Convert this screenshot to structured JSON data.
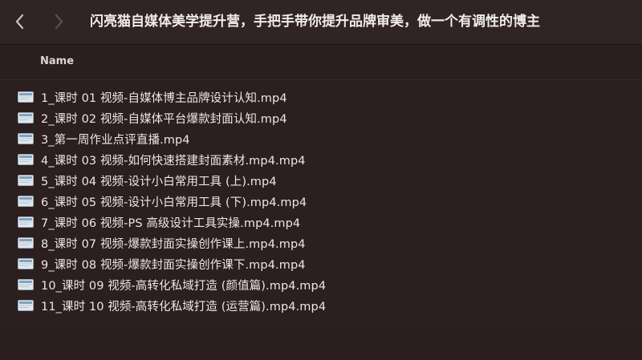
{
  "window": {
    "title": "闪亮猫自媒体美学提升营，手把手带你提升品牌审美，做一个有调性的博主"
  },
  "toolbar": {
    "back_icon": "chevron-left-icon",
    "forward_icon": "chevron-right-icon"
  },
  "list_header": {
    "name_label": "Name"
  },
  "files": [
    {
      "name": "1_课时 01 视频-自媒体博主品牌设计认知.mp4"
    },
    {
      "name": "2_课时 02 视频-自媒体平台爆款封面认知.mp4"
    },
    {
      "name": "3_第一周作业点评直播.mp4"
    },
    {
      "name": "4_课时 03 视频-如何快速搭建封面素材.mp4.mp4"
    },
    {
      "name": "5_课时 04 视频-设计小白常用工具 (上).mp4"
    },
    {
      "name": "6_课时 05 视频-设计小白常用工具 (下).mp4.mp4"
    },
    {
      "name": "7_课时 06 视频-PS 高级设计工具实操.mp4.mp4"
    },
    {
      "name": "8_课时 07 视频-爆款封面实操创作课上.mp4.mp4"
    },
    {
      "name": "9_课时 08 视频-爆款封面实操创作课下.mp4.mp4"
    },
    {
      "name": "10_课时 09 视频-高转化私域打造 (颜值篇).mp4.mp4"
    },
    {
      "name": "11_课时 10 视频-高转化私域打造 (运营篇).mp4.mp4"
    }
  ],
  "colors": {
    "background": "#2b1f20",
    "text": "#ece7e7",
    "nav_icon_active": "#c9c1c1",
    "nav_icon_disabled": "#5b4f50"
  }
}
